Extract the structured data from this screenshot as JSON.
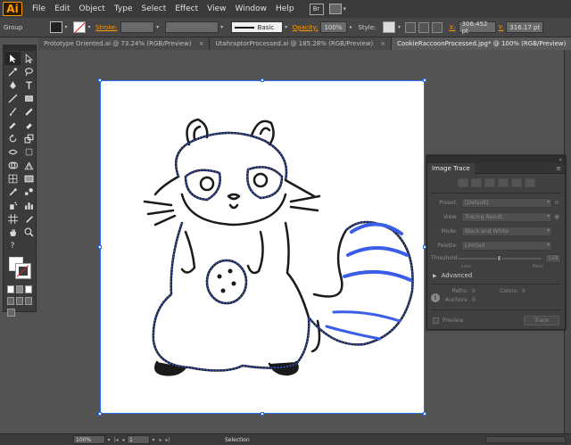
{
  "app": {
    "logo_text": "Ai",
    "accent": "#ff9a00"
  },
  "menu": [
    "File",
    "Edit",
    "Object",
    "Type",
    "Select",
    "Effect",
    "View",
    "Window",
    "Help"
  ],
  "menu_br": "Br",
  "controlbar": {
    "group_label": "Group",
    "stroke_label": "Stroke:",
    "brush_label": "Basic",
    "opacity_label": "Opacity:",
    "opacity_value": "100%",
    "style_label": "Style:",
    "x_label": "X:",
    "x_value": "306.452 pt",
    "y_label": "Y:",
    "y_value": "316.17 pt"
  },
  "tabs": [
    {
      "label": "Prototype Oriented.ai @ 73.24% (RGB/Preview)",
      "active": false
    },
    {
      "label": "UtahraptorProcessed.ai @ 185.28% (RGB/Preview)",
      "active": false
    },
    {
      "label": "CookieRaccoonProcessed.jpg* @ 100% (RGB/Preview)",
      "active": true
    }
  ],
  "tab_close": "×",
  "trace_panel": {
    "title": "Image Trace",
    "preset_label": "Preset:",
    "preset_value": "[Default]",
    "view_label": "View:",
    "view_value": "Tracing Result",
    "mode_label": "Mode:",
    "mode_value": "Black and White",
    "palette_label": "Palette:",
    "palette_value": "Limited",
    "threshold_label": "Threshold:",
    "threshold_value": "128",
    "threshold_fraction": 0.5,
    "less_label": "Less",
    "more_label": "More",
    "advanced_label": "Advanced",
    "paths_label": "Paths:",
    "paths_value": "0",
    "colors_label": "Colors:",
    "colors_value": "0",
    "anchors_label": "Anchors:",
    "anchors_value": "0",
    "preview_label": "Preview",
    "trace_button": "Trace"
  },
  "status": {
    "zoom": "100%",
    "page": "1",
    "mode": "Selection"
  },
  "colors": {
    "selection": "#2a6ef0",
    "trace_ink": "#000000"
  }
}
